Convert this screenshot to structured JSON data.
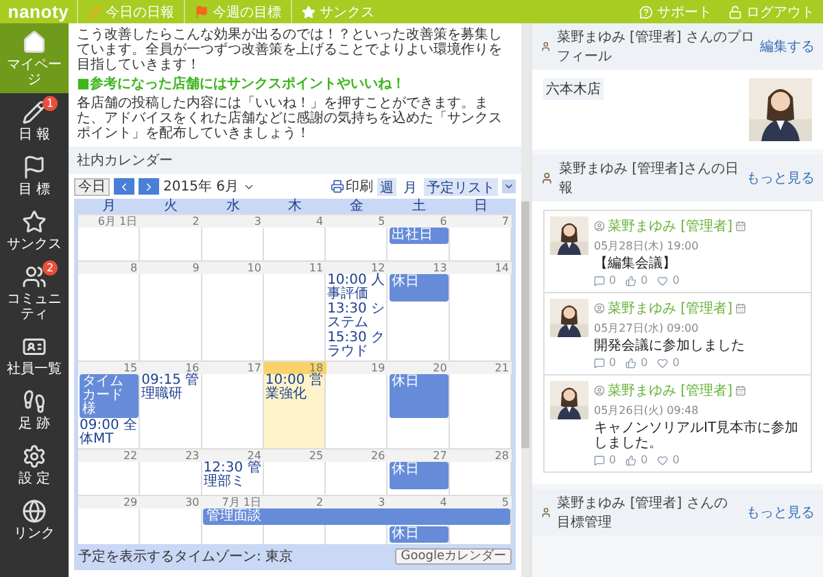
{
  "header": {
    "logo": "nanoty",
    "nav": [
      "今日の日報",
      "今週の目標",
      "サンクス"
    ],
    "utility": [
      "サポート",
      "ログアウト"
    ]
  },
  "sidebar": {
    "items": [
      {
        "label": "マイページ",
        "selected": true
      },
      {
        "label": "日 報",
        "selected": false,
        "badge": "1"
      },
      {
        "label": "目 標",
        "selected": false
      },
      {
        "label": "サンクス",
        "selected": false
      },
      {
        "label": "コミュニティ",
        "selected": false,
        "badge": "2"
      },
      {
        "label": "社員一覧",
        "selected": false
      },
      {
        "label": "足 跡",
        "selected": false
      },
      {
        "label": "設 定",
        "selected": false
      },
      {
        "label": "リンク",
        "selected": false
      }
    ]
  },
  "notice": [
    {
      "kind": "text",
      "text": "こう改善したらこんな効果が出るのでは！？といった改善策を募集しています。全員が一つずつ改善策を上げることでよりよい環境作りを目指していきます！"
    },
    {
      "kind": "heading",
      "text": "■参考になった店舗にはサンクスポイントやいいね！"
    },
    {
      "kind": "text",
      "text": "各店舗の投稿した内容には「いいね！」を押すことができます。また、アドバイスをくれた店舗などに感謝の気持ちを込めた「サンクスポイント」を配布していきましょう！"
    }
  ],
  "calendar": {
    "title": "社内カレンダー",
    "today_button": "今日",
    "month": "2015年 6月",
    "print": "印刷",
    "views": [
      {
        "label": "週",
        "selected": false
      },
      {
        "label": "月",
        "selected": true
      },
      {
        "label": "予定リスト",
        "selected": false
      }
    ],
    "weekdays": [
      "月",
      "火",
      "水",
      "木",
      "金",
      "土",
      "日"
    ],
    "weeks": [
      {
        "days": [
          {
            "label": "6月 1日",
            "today": false
          },
          {
            "label": "2",
            "today": false
          },
          {
            "label": "3",
            "today": false
          },
          {
            "label": "4",
            "today": false
          },
          {
            "label": "5",
            "today": false
          },
          {
            "label": "6",
            "today": false,
            "events": [
              {
                "kind": "bar",
                "text": "出社日"
              }
            ]
          },
          {
            "label": "7",
            "today": false
          }
        ]
      },
      {
        "days": [
          {
            "label": "8",
            "today": false
          },
          {
            "label": "9",
            "today": false
          },
          {
            "label": "10",
            "today": false
          },
          {
            "label": "11",
            "today": false
          },
          {
            "label": "12",
            "today": false,
            "events": [
              {
                "kind": "timed",
                "text": "10:00 人事評価"
              },
              {
                "kind": "timed",
                "text": "13:30 システム"
              },
              {
                "kind": "timed",
                "text": "15:30 クラウド"
              }
            ]
          },
          {
            "label": "13",
            "today": false,
            "events": [
              {
                "kind": "bar",
                "text": "休日"
              }
            ]
          },
          {
            "label": "14",
            "today": false
          }
        ]
      },
      {
        "days": [
          {
            "label": "15",
            "today": false,
            "events": [
              {
                "kind": "bar",
                "text": "タイムカード様"
              },
              {
                "kind": "timed",
                "text": "09:00 全体MT"
              }
            ]
          },
          {
            "label": "16",
            "today": false,
            "events": [
              {
                "kind": "timed",
                "text": "09:15 管理職研"
              }
            ]
          },
          {
            "label": "17",
            "today": false
          },
          {
            "label": "18",
            "today": true,
            "events": [
              {
                "kind": "timed",
                "text": "10:00 営業強化"
              }
            ]
          },
          {
            "label": "19",
            "today": false
          },
          {
            "label": "20",
            "today": false,
            "events": [
              {
                "kind": "bar",
                "text": "休日"
              }
            ]
          },
          {
            "label": "21",
            "today": false
          }
        ]
      },
      {
        "days": [
          {
            "label": "22",
            "today": false
          },
          {
            "label": "23",
            "today": false
          },
          {
            "label": "24",
            "today": false,
            "events": [
              {
                "kind": "timed",
                "text": "12:30 管理部ミ"
              }
            ]
          },
          {
            "label": "25",
            "today": false
          },
          {
            "label": "26",
            "today": false
          },
          {
            "label": "27",
            "today": false,
            "events": [
              {
                "kind": "bar",
                "text": "休日"
              }
            ]
          },
          {
            "label": "28",
            "today": false
          }
        ]
      },
      {
        "days": [
          {
            "label": "29",
            "today": false
          },
          {
            "label": "30",
            "today": false
          },
          {
            "label": "7月 1日",
            "today": false,
            "events": [
              {
                "kind": "span",
                "text": "管理面談"
              }
            ]
          },
          {
            "label": "2",
            "today": false
          },
          {
            "label": "3",
            "today": false
          },
          {
            "label": "4",
            "today": false,
            "events": [
              {
                "kind": "bar",
                "text": "休日"
              }
            ]
          },
          {
            "label": "5",
            "today": false
          }
        ]
      }
    ],
    "timezone": "予定を表示するタイムゾーン: 東京",
    "google_button": "Googleカレンダー"
  },
  "profile": {
    "title": "菜野まゆみ [管理者] さんのプロフィール",
    "link": "編集する",
    "store": "六本木店"
  },
  "diary": {
    "title": "菜野まゆみ [管理者]さんの日報",
    "link": "もっと見る",
    "entries": [
      {
        "author": "菜野まゆみ [管理者]",
        "date": "05月28日(木) 19:00",
        "text": "【編集会議】",
        "comments": "0",
        "likes": "0",
        "thanks": "0"
      },
      {
        "author": "菜野まゆみ [管理者]",
        "date": "05月27日(水) 09:00",
        "text": "開発会議に参加しました",
        "comments": "0",
        "likes": "0",
        "thanks": "0"
      },
      {
        "author": "菜野まゆみ [管理者]",
        "date": "05月26日(火) 09:48",
        "text": "キャノンソリアルIT見本市に参加しました。",
        "comments": "0",
        "likes": "0",
        "thanks": "0"
      }
    ]
  },
  "goals": {
    "title": "菜野まゆみ [管理者] さんの目標管理",
    "link": "もっと見る"
  }
}
